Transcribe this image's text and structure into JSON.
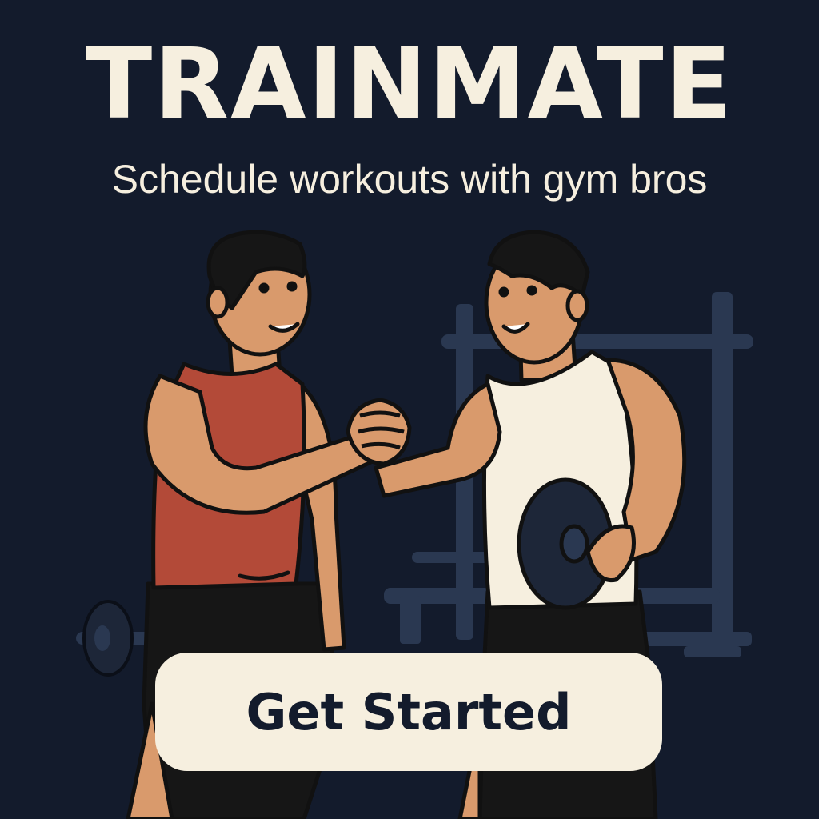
{
  "app": {
    "title": "TRAINMATE",
    "subtitle": "Schedule workouts with gym bros"
  },
  "hero": {
    "description_icon": "two-athletes-handshake-illustration"
  },
  "cta": {
    "label": "Get Started"
  },
  "colors": {
    "background": "#131b2c",
    "cream": "#f6efdf",
    "red_tank": "#b34a38",
    "skin": "#d99a6c",
    "equipment": "#2a3851"
  }
}
